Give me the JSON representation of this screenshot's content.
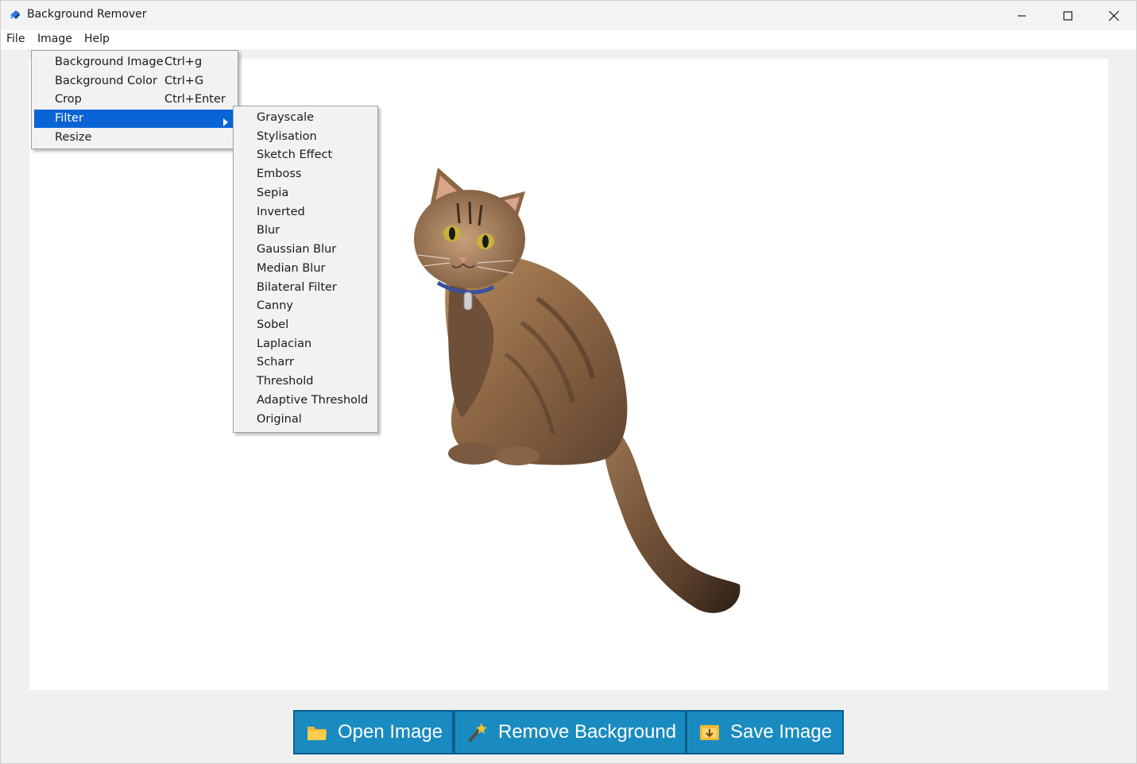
{
  "window": {
    "title": "Background Remover"
  },
  "menubar": [
    "File",
    "Image",
    "Help"
  ],
  "image_menu": {
    "items": [
      {
        "label": "Background Image",
        "shortcut": "Ctrl+g"
      },
      {
        "label": "Background Color",
        "shortcut": "Ctrl+G"
      },
      {
        "label": "Crop",
        "shortcut": "Ctrl+Enter"
      },
      {
        "label": "Filter",
        "shortcut": ""
      },
      {
        "label": "Resize",
        "shortcut": ""
      }
    ],
    "highlighted": "Filter"
  },
  "filter_submenu": [
    "Grayscale",
    "Stylisation",
    "Sketch Effect",
    "Emboss",
    "Sepia",
    "Inverted",
    "Blur",
    "Gaussian Blur",
    "Median Blur",
    "Bilateral Filter",
    "Canny",
    "Sobel",
    "Laplacian",
    "Scharr",
    "Threshold",
    "Adaptive Threshold",
    "Original"
  ],
  "buttons": {
    "open": "Open Image",
    "remove": "Remove Background",
    "save": "Save Image"
  },
  "colors": {
    "button_bg": "#1a8bc0",
    "highlight": "#0a64d6"
  }
}
